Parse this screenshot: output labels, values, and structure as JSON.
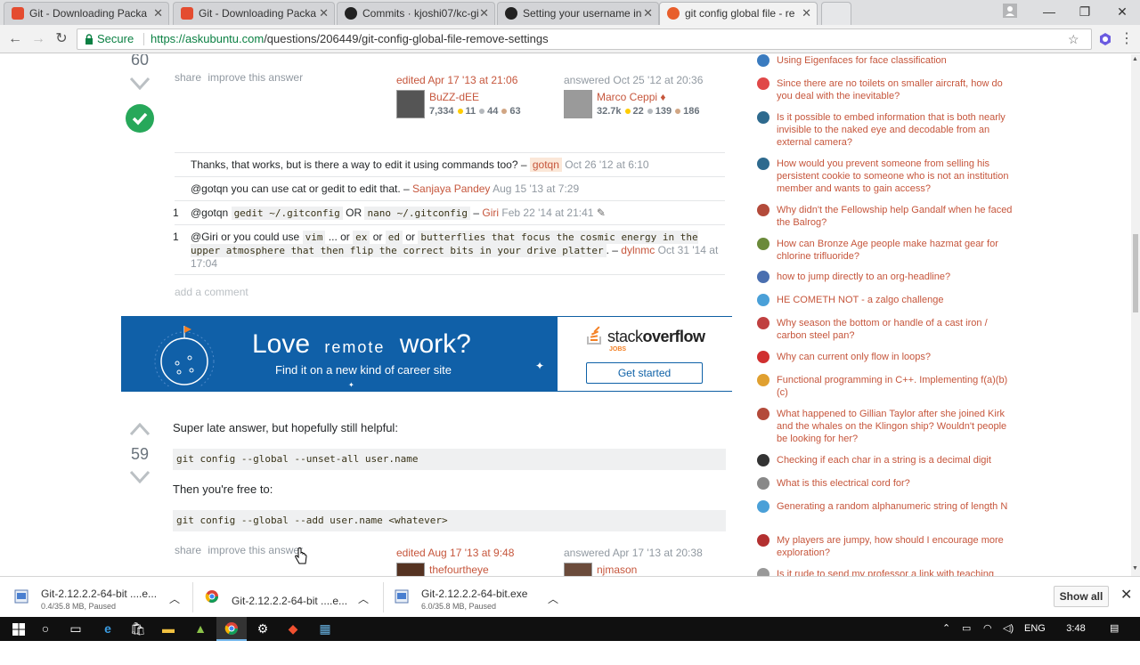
{
  "browser": {
    "tabs": [
      {
        "label": "Git - Downloading Packa",
        "icon": "git-icon",
        "active": false
      },
      {
        "label": "Git - Downloading Packa",
        "icon": "git-icon",
        "active": false
      },
      {
        "label": "Commits · kjoshi07/kc-gi",
        "icon": "github-icon",
        "active": false
      },
      {
        "label": "Setting your username in",
        "icon": "github-icon",
        "active": false
      },
      {
        "label": "git config global file - re",
        "icon": "askubuntu-icon",
        "active": true
      }
    ],
    "secure_label": "Secure",
    "url_host": "https://askubuntu.com",
    "url_path": "/questions/206449/git-config-global-file-remove-settings"
  },
  "answer1": {
    "score": "60",
    "share": "share",
    "improve": "improve this answer",
    "edited": {
      "action": "edited Apr 17 '13 at 21:06",
      "user": "BuZZ-dEE",
      "rep": "7,334",
      "gold": "11",
      "silver": "44",
      "bronze": "63"
    },
    "answered": {
      "action": "answered Oct 25 '12 at 20:36",
      "user": "Marco Ceppi",
      "mod": "♦",
      "rep": "32.7k",
      "gold": "22",
      "silver": "139",
      "bronze": "186"
    },
    "comments": [
      {
        "score": "",
        "text": "Thanks, that works, but is there a way to edit it using commands too? –",
        "user": "gotqn",
        "date": "Oct 26 '12 at 6:10"
      },
      {
        "score": "",
        "text": "@gotqn you can use cat or gedit to edit that. –",
        "user": "Sanjaya Pandey",
        "date": "Aug 15 '13 at 7:29"
      },
      {
        "score": "1",
        "pre": "@gotqn",
        "code1": "gedit ~/.gitconfig",
        "mid": "OR",
        "code2": "nano ~/.gitconfig",
        "user": "Giri",
        "date": "Feb 22 '14 at 21:41"
      },
      {
        "score": "1",
        "pre": "@Giri or you could use",
        "code1": "vim",
        "t1": "... or",
        "code2": "ex",
        "t2": "or",
        "code3": "ed",
        "t3": "or",
        "code4": "butterflies that focus the cosmic energy in the upper atmosphere that then flip the correct bits in your drive platter",
        "t4": ". –",
        "user": "dylnmc",
        "date": "Oct 31 '14 at 17:04"
      }
    ],
    "add_comment": "add a comment"
  },
  "ad": {
    "love": "Love",
    "remote": "remote",
    "work": "work?",
    "subtitle": "Find it on a new kind of career site",
    "brand_stack": "stack",
    "brand_overflow": "overflow",
    "brand_jobs": "JOBS",
    "cta": "Get started"
  },
  "answer2": {
    "score": "59",
    "intro": "Super late answer, but hopefully still helpful:",
    "code1": "git config --global --unset-all user.name",
    "then": "Then you're free to:",
    "code2": "git config --global --add user.name <whatever>",
    "share": "share",
    "improve": "improve this answer",
    "edited": {
      "action": "edited Aug 17 '13 at 9:48",
      "user": "thefourtheye"
    },
    "answered": {
      "action": "answered Apr 17 '13 at 20:38",
      "user": "njmason"
    }
  },
  "hot_questions": [
    {
      "title": "Using Eigenfaces for face classification",
      "icon_color": "#3a7bbf"
    },
    {
      "title": "Since there are no toilets on smaller aircraft, how do you deal with the inevitable?",
      "icon_color": "#e04848"
    },
    {
      "title": "Is it possible to embed information that is both nearly invisible to the naked eye and decodable from an external camera?",
      "icon_color": "#2e6a8e"
    },
    {
      "title": "How would you prevent someone from selling his persistent cookie to someone who is not an institution member and wants to gain access?",
      "icon_color": "#2e6a8e"
    },
    {
      "title": "Why didn't the Fellowship help Gandalf when he faced the Balrog?",
      "icon_color": "#b34a3a"
    },
    {
      "title": "How can Bronze Age people make hazmat gear for chlorine trifluoride?",
      "icon_color": "#6b8a3a"
    },
    {
      "title": "how to jump directly to an org-headline?",
      "icon_color": "#4a6fb0"
    },
    {
      "title": "HE COMETH NOT - a zalgo challenge",
      "icon_color": "#4aa0d8"
    },
    {
      "title": "Why season the bottom or handle of a cast iron / carbon steel pan?",
      "icon_color": "#c04040"
    },
    {
      "title": "Why can current only flow in loops?",
      "icon_color": "#d03030"
    },
    {
      "title": "Functional programming in C++. Implementing f(a)(b)(c)",
      "icon_color": "#e0a030"
    },
    {
      "title": "What happened to Gillian Taylor after she joined Kirk and the whales on the Klingon ship? Wouldn't people be looking for her?",
      "icon_color": "#b34a3a"
    },
    {
      "title": "Checking if each char in a string is a decimal digit",
      "icon_color": "#333333"
    },
    {
      "title": "What is this electrical cord for?",
      "icon_color": "#888888"
    },
    {
      "title": "Generating a random alphanumeric string of length N",
      "icon_color": "#4aa0d8"
    },
    {
      "title": "My players are jumpy, how should I encourage more exploration?",
      "icon_color": "#b33030"
    },
    {
      "title": "Is it rude to send my professor a link with teaching",
      "icon_color": "#999999"
    }
  ],
  "downloads": [
    {
      "name": "Git-2.12.2.2-64-bit ....e...",
      "status": "0.4/35.8 MB, Paused",
      "icon": "installer-file-icon"
    },
    {
      "name": "Git-2.12.2.2-64-bit ....e...",
      "status": "",
      "icon": "chrome-file-icon"
    },
    {
      "name": "Git-2.12.2.2-64-bit.exe",
      "status": "6.0/35.8 MB, Paused",
      "icon": "installer-file-icon"
    }
  ],
  "show_all": "Show all",
  "taskbar": {
    "lang": "ENG",
    "time": "3:48 PM"
  },
  "colors": {
    "link": "#c6563c",
    "ad_blue": "#1060a8",
    "accepted": "#27a85a"
  }
}
